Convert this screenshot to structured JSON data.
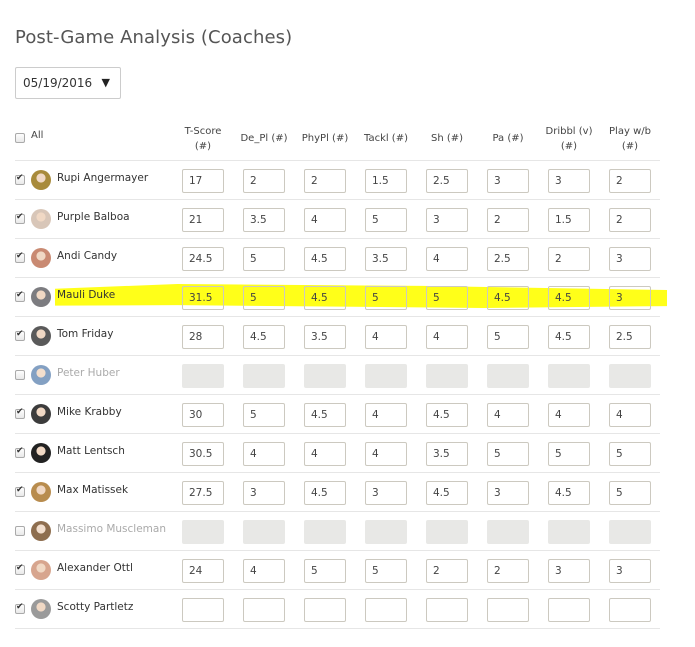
{
  "page": {
    "title": "Post-Game Analysis (Coaches)"
  },
  "date_select": {
    "value": "05/19/2016",
    "caret": "▼"
  },
  "table": {
    "select_all_label": "All",
    "select_all_checked": false,
    "columns": [
      {
        "key": "t_score",
        "label_line1": "T-Score",
        "label_line2": "(#)"
      },
      {
        "key": "de_pl",
        "label_line1": "De_Pl (#)",
        "label_line2": ""
      },
      {
        "key": "phypl",
        "label_line1": "PhyPl (#)",
        "label_line2": ""
      },
      {
        "key": "tackl",
        "label_line1": "Tackl (#)",
        "label_line2": ""
      },
      {
        "key": "sh",
        "label_line1": "Sh (#)",
        "label_line2": ""
      },
      {
        "key": "pa",
        "label_line1": "Pa (#)",
        "label_line2": ""
      },
      {
        "key": "dribbl",
        "label_line1": "Dribbl (v)",
        "label_line2": "(#)"
      },
      {
        "key": "play_wb",
        "label_line1": "Play w/b",
        "label_line2": "(#)"
      }
    ],
    "rows": [
      {
        "name": "Rupi Angermayer",
        "checked": true,
        "highlighted": false,
        "avatar_color": "#a88a3a",
        "values": [
          "17",
          "2",
          "2",
          "1.5",
          "2.5",
          "3",
          "3",
          "2"
        ]
      },
      {
        "name": "Purple Balboa",
        "checked": true,
        "highlighted": false,
        "avatar_color": "#d8c6b8",
        "values": [
          "21",
          "3.5",
          "4",
          "5",
          "3",
          "2",
          "1.5",
          "2"
        ]
      },
      {
        "name": "Andi Candy",
        "checked": true,
        "highlighted": false,
        "avatar_color": "#c98a72",
        "values": [
          "24.5",
          "5",
          "4.5",
          "3.5",
          "4",
          "2.5",
          "2",
          "3"
        ]
      },
      {
        "name": "Mauli Duke",
        "checked": true,
        "highlighted": true,
        "avatar_color": "#7c7c80",
        "values": [
          "31.5",
          "5",
          "4.5",
          "5",
          "5",
          "4.5",
          "4.5",
          "3"
        ]
      },
      {
        "name": "Tom Friday",
        "checked": true,
        "highlighted": false,
        "avatar_color": "#5a5a5a",
        "values": [
          "28",
          "4.5",
          "3.5",
          "4",
          "4",
          "5",
          "4.5",
          "2.5"
        ]
      },
      {
        "name": "Peter Huber",
        "checked": false,
        "highlighted": false,
        "avatar_color": "#6d8fb8",
        "values": [
          "",
          "",
          "",
          "",
          "",
          "",
          "",
          ""
        ]
      },
      {
        "name": "Mike Krabby",
        "checked": true,
        "highlighted": false,
        "avatar_color": "#3c3c3c",
        "values": [
          "30",
          "5",
          "4.5",
          "4",
          "4.5",
          "4",
          "4",
          "4"
        ]
      },
      {
        "name": "Matt Lentsch",
        "checked": true,
        "highlighted": false,
        "avatar_color": "#222222",
        "values": [
          "30.5",
          "4",
          "4",
          "4",
          "3.5",
          "5",
          "5",
          "5"
        ]
      },
      {
        "name": "Max Matissek",
        "checked": true,
        "highlighted": false,
        "avatar_color": "#b88c4e",
        "values": [
          "27.5",
          "3",
          "4.5",
          "3",
          "4.5",
          "3",
          "4.5",
          "5"
        ]
      },
      {
        "name": "Massimo Muscleman",
        "checked": false,
        "highlighted": false,
        "avatar_color": "#7a5430",
        "values": [
          "",
          "",
          "",
          "",
          "",
          "",
          "",
          ""
        ]
      },
      {
        "name": "Alexander Ottl",
        "checked": true,
        "highlighted": false,
        "avatar_color": "#d7a58e",
        "values": [
          "24",
          "4",
          "5",
          "5",
          "2",
          "2",
          "3",
          "3"
        ]
      },
      {
        "name": "Scotty Partletz",
        "checked": true,
        "highlighted": false,
        "avatar_color": "#9a9a9a",
        "values": [
          "",
          "",
          "",
          "",
          "",
          "",
          "",
          ""
        ]
      }
    ]
  },
  "colors": {
    "highlight": "#ffff00",
    "disabled_input": "#e8e8e6",
    "row_divider": "#e6e6e6"
  }
}
